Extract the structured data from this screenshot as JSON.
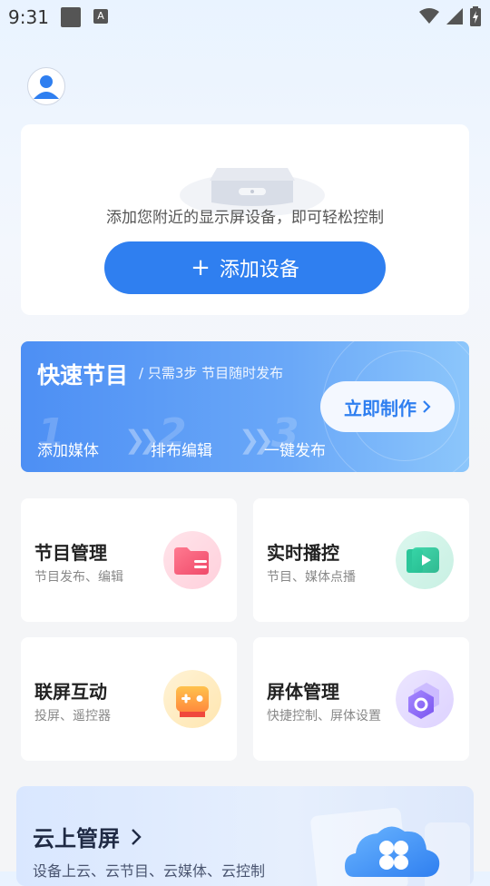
{
  "status_bar": {
    "time": "9:31",
    "notification_badge": "A"
  },
  "device_card": {
    "empty_text": "添加您附近的显示屏设备，即可轻松控制",
    "add_button_label": "添加设备"
  },
  "quick_program": {
    "title": "快速节目",
    "subtitle": "/ 只需3步 节目随时发布",
    "steps": [
      {
        "number": "1",
        "label": "添加媒体"
      },
      {
        "number": "2",
        "label": "排布编辑"
      },
      {
        "number": "3",
        "label": "一键发布"
      }
    ],
    "action_label": "立即制作"
  },
  "features": [
    {
      "title": "节目管理",
      "subtitle": "节目发布、编辑",
      "icon": "folder-icon"
    },
    {
      "title": "实时播控",
      "subtitle": "节目、媒体点播",
      "icon": "play-icon"
    },
    {
      "title": "联屏互动",
      "subtitle": "投屏、遥控器",
      "icon": "gamepad-icon"
    },
    {
      "title": "屏体管理",
      "subtitle": "快捷控制、屏体设置",
      "icon": "hex-nut-icon"
    }
  ],
  "cloud": {
    "title": "云上管屏",
    "subtitle": "设备上云、云节目、云媒体、云控制"
  },
  "colors": {
    "primary": "#2f7ff0",
    "banner_start": "#4d8ff4",
    "banner_end": "#8cc6fb"
  }
}
